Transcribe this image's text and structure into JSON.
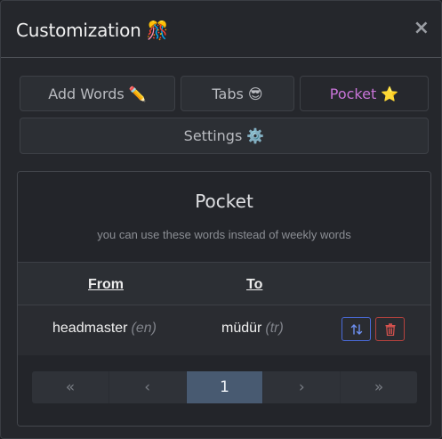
{
  "modal": {
    "title": "Customization 🎊",
    "close": "×"
  },
  "tabs": [
    {
      "label": "Add Words ✏️",
      "active": false
    },
    {
      "label": "Tabs 😎",
      "active": false
    },
    {
      "label": "Pocket ⭐",
      "active": true
    },
    {
      "label": "Settings ⚙️",
      "active": false
    }
  ],
  "pocket": {
    "title": "Pocket",
    "subtitle": "you can use these words instead of weekly words",
    "columns": {
      "from": "From",
      "to": "To"
    },
    "rows": [
      {
        "from_word": "headmaster",
        "from_lang": "(en)",
        "to_word": "müdür",
        "to_lang": "(tr)"
      }
    ],
    "actions": {
      "swap_icon": "swap-vertical-icon",
      "delete_icon": "trash-icon"
    }
  },
  "pagination": {
    "first": "«",
    "prev": "‹",
    "current": "1",
    "next": "›",
    "last": "»"
  },
  "colors": {
    "active_tab": "#c874d8",
    "swap_button": "#4a6ad8",
    "delete_button": "#d9534f",
    "active_page": "#485a71"
  }
}
